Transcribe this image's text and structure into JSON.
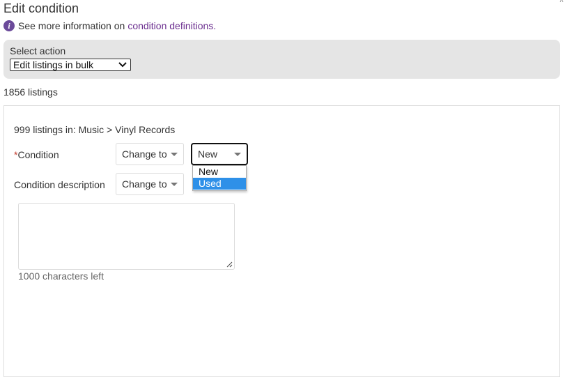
{
  "dialog": {
    "title": "Edit condition",
    "info_text": "See more information on",
    "info_link": "condition definitions."
  },
  "action": {
    "label": "Select action",
    "selected": "Edit listings in bulk"
  },
  "listing_count": "1856 listings",
  "group": {
    "breadcrumb": "999 listings in: Music > Vinyl Records",
    "condition": {
      "required_mark": "*",
      "label": "Condition",
      "mode": "Change to",
      "value": "New",
      "options": [
        "New",
        "Used"
      ],
      "highlighted_option": "Used"
    },
    "description": {
      "label": "Condition description",
      "mode": "Change to",
      "chars_left": "1000 characters left"
    }
  },
  "colors": {
    "link": "#6b2e8f",
    "info_icon": "#6b4a9a",
    "highlight": "#2e90e8",
    "required": "#c0392b",
    "panel_bg": "#e5e5e5"
  }
}
